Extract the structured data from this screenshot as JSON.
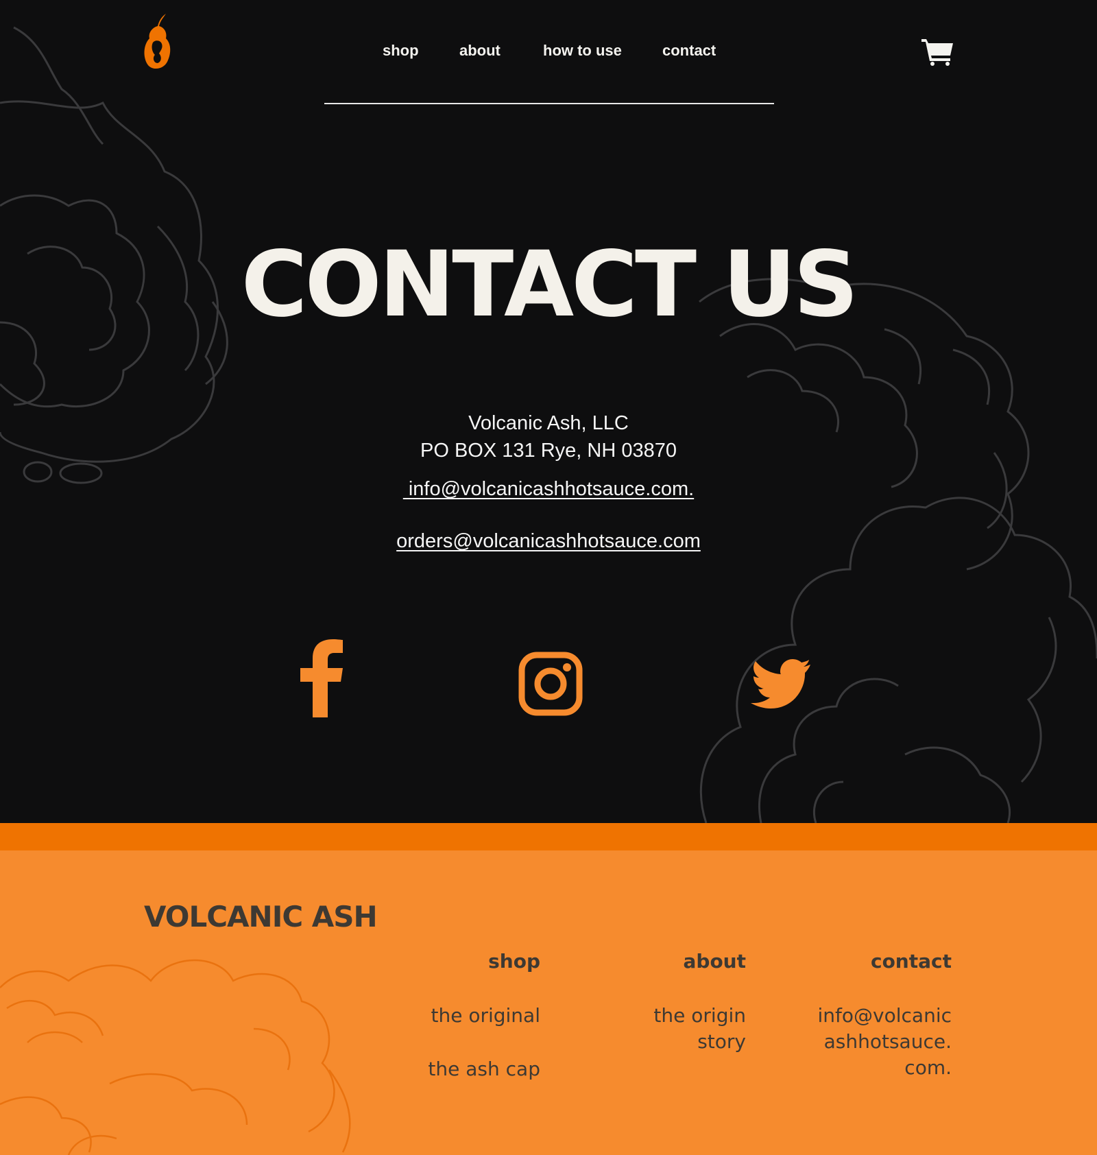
{
  "colors": {
    "background": "#0e0e0f",
    "accent": "#ef7301",
    "footer_bg": "#f68b2e",
    "text_light": "#f4f3ef",
    "text_dark": "#3d3933",
    "social": "#f68b2e"
  },
  "header": {
    "logo_icon": "pepper-logo-icon",
    "nav": [
      "shop",
      "about",
      "how to use",
      "contact"
    ],
    "cart_icon": "cart-icon"
  },
  "contact": {
    "title": "CONTACT US",
    "company": "Volcanic Ash, LLC",
    "address": "PO BOX 131 Rye, NH 03870",
    "email_info": " info@volcanicashhotsauce.com.",
    "email_orders": "orders@volcanicashhotsauce.com"
  },
  "social": [
    "facebook-icon",
    "instagram-icon",
    "twitter-icon"
  ],
  "footer": {
    "brand": "VOLCANIC ASH",
    "columns": [
      {
        "heading": "shop",
        "links": [
          "the original",
          "the ash cap"
        ]
      },
      {
        "heading": "about",
        "lines": [
          "the origin",
          "story"
        ]
      },
      {
        "heading": "contact",
        "lines": [
          "info@volcanic",
          "ashhotsauce.",
          "com."
        ]
      }
    ]
  }
}
